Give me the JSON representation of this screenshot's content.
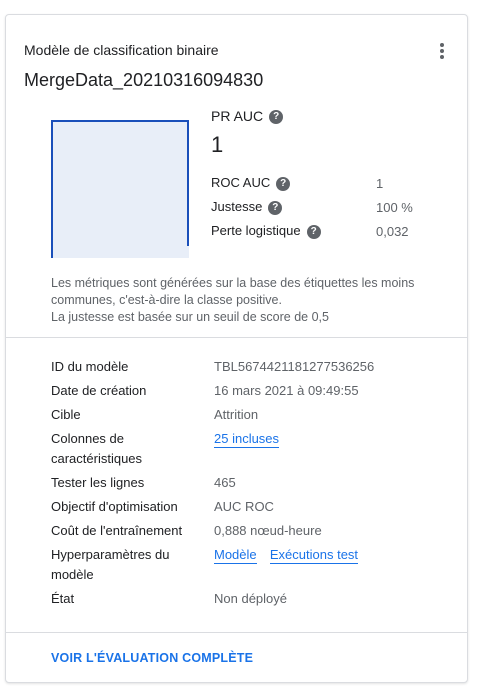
{
  "card": {
    "subtitle": "Modèle de classification binaire",
    "title": "MergeData_20210316094830"
  },
  "metrics": {
    "pr_auc_label": "PR AUC",
    "pr_auc_value": "1",
    "rows": [
      {
        "label": "ROC AUC",
        "value": "1"
      },
      {
        "label": "Justesse",
        "value": "100 %"
      },
      {
        "label": "Perte logistique",
        "value": "0,032"
      }
    ]
  },
  "note": {
    "line1": "Les métriques sont générées sur la base des étiquettes les moins communes, c'est-à-dire la classe positive.",
    "line2": "La justesse est basée sur un seuil de score de 0,5"
  },
  "details": {
    "model_id_label": "ID du modèle",
    "model_id_value": "TBL5674421181277536256",
    "created_label": "Date de création",
    "created_value": "16 mars 2021 à 09:49:55",
    "target_label": "Cible",
    "target_value": "Attrition",
    "features_label": "Colonnes de caractéristiques",
    "features_value": "25 incluses",
    "test_rows_label": "Tester les lignes",
    "test_rows_value": "465",
    "objective_label": "Objectif d'optimisation",
    "objective_value": "AUC ROC",
    "cost_label": "Coût de l'entraînement",
    "cost_value": "0,888 nœud-heure",
    "hyper_label": "Hyperparamètres du modèle",
    "hyper_link1": "Modèle",
    "hyper_link2": "Exécutions test",
    "state_label": "État",
    "state_value": "Non déployé"
  },
  "footer": {
    "link": "VOIR L'ÉVALUATION COMPLÈTE"
  },
  "colors": {
    "accent": "#1a73e8",
    "chart_fill": "#e8eef8",
    "chart_line": "#1a4fba"
  },
  "icons": [
    "more-vert-icon",
    "help-icon"
  ]
}
